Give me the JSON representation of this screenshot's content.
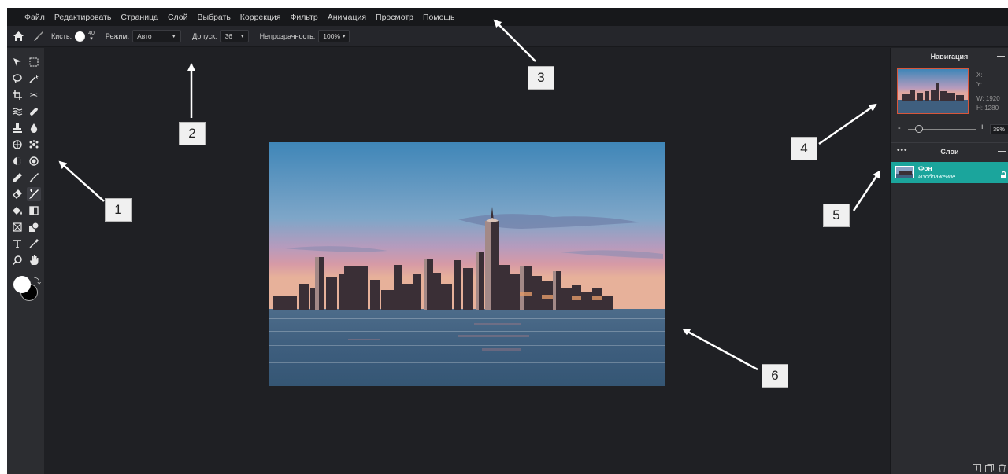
{
  "menu": [
    "Файл",
    "Редактировать",
    "Страница",
    "Слой",
    "Выбрать",
    "Коррекция",
    "Фильтр",
    "Анимация",
    "Просмотр",
    "Помощь"
  ],
  "options": {
    "brush_label": "Кисть:",
    "brush_size": "40",
    "mode_label": "Режим:",
    "mode_value": "Авто",
    "tolerance_label": "Допуск:",
    "tolerance_value": "36",
    "opacity_label": "Непрозрачность:",
    "opacity_value": "100%"
  },
  "tools": [
    "move-icon",
    "marquee-icon",
    "lasso-icon",
    "magic-wand-icon",
    "crop-icon",
    "scissors-icon",
    "liquify-icon",
    "healing-icon",
    "clone-stamp-icon",
    "blur-icon",
    "sponge-icon",
    "spot-icon",
    "dodge-icon",
    "burn-icon",
    "pencil-icon",
    "brush-icon",
    "eraser-icon",
    "replace-color-icon",
    "fill-icon",
    "gradient-icon",
    "placeholder-icon",
    "shape-icon",
    "type-icon",
    "eyedropper-icon",
    "zoom-icon",
    "hand-icon"
  ],
  "colors": {
    "foreground": "#ffffff",
    "background": "#000000",
    "accent_layer": "#1ba59c",
    "selection_border": "#d8563a"
  },
  "navigator": {
    "title": "Навигация",
    "x_label": "X:",
    "y_label": "Y:",
    "w_label": "W:",
    "w_value": "1920",
    "h_label": "H:",
    "h_value": "1280",
    "zoom_value": "39%"
  },
  "layers": {
    "title": "Слои",
    "items": [
      {
        "name": "Фон",
        "type": "Изображение",
        "locked": true
      }
    ]
  },
  "annotations": [
    "1",
    "2",
    "3",
    "4",
    "5",
    "6"
  ]
}
